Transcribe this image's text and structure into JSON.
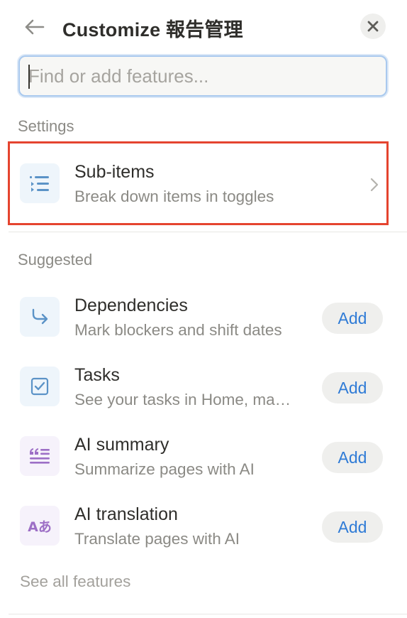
{
  "header": {
    "title": "Customize 報告管理",
    "back_icon": "arrow-left-icon",
    "close_icon": "close-icon"
  },
  "search": {
    "placeholder": "Find or add features...",
    "value": ""
  },
  "settings": {
    "label": "Settings",
    "items": [
      {
        "title": "Sub-items",
        "description": "Break down items in toggles",
        "icon": "sub-items-list-icon"
      }
    ]
  },
  "suggested": {
    "label": "Suggested",
    "add_label": "Add",
    "items": [
      {
        "title": "Dependencies",
        "description": "Mark blockers and shift dates",
        "icon": "dependency-arrow-icon"
      },
      {
        "title": "Tasks",
        "description": "See your tasks in Home, ma…",
        "icon": "checkbox-icon"
      },
      {
        "title": "AI summary",
        "description": "Summarize pages with AI",
        "icon": "ai-summary-quote-icon"
      },
      {
        "title": "AI translation",
        "description": "Translate pages with AI",
        "icon": "ai-translation-icon",
        "icon_text": "Aあ"
      }
    ]
  },
  "footer": {
    "see_all_label": "See all features"
  },
  "colors": {
    "accent_blue": "#2f7bd6",
    "highlight_red": "#e5442f",
    "ai_purple": "#9d6fc6"
  }
}
